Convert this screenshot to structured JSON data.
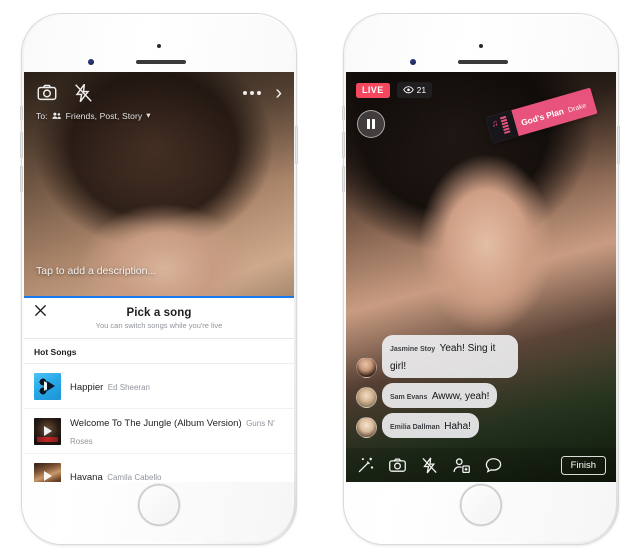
{
  "phone_left": {
    "name": "facebook-live-camera-song-picker",
    "camera_bar": {
      "flip_camera_icon": "camera-flip-icon",
      "flash_icon": "flash-off-icon",
      "more_icon": "more-options-icon",
      "next_icon": "chevron-right-icon"
    },
    "audience": {
      "prefix": "To:",
      "friends_icon": "friends-icon",
      "text": "Friends, Post, Story",
      "caret": "▾"
    },
    "description_placeholder": "Tap to add a description...",
    "sheet": {
      "close_icon": "close-icon",
      "title": "Pick a song",
      "subtitle": "You can switch songs while you're live",
      "section": "Hot Songs",
      "songs": [
        {
          "title": "Happier",
          "artist": "Ed Sheeran",
          "art": "a1"
        },
        {
          "title": "Welcome To The Jungle (Album Version)",
          "artist": "Guns N' Roses",
          "art": "a2"
        },
        {
          "title": "Havana",
          "artist": "Camila Cabello",
          "art": "a3"
        }
      ]
    }
  },
  "phone_right": {
    "name": "facebook-live-broadcast",
    "live_label": "LIVE",
    "viewer_icon": "eye-icon",
    "viewer_count": "21",
    "pause_icon": "pause-icon",
    "music_sticker": {
      "title": "God's Plan",
      "artist": "Drake",
      "note_icon": "music-note-icon"
    },
    "comments": [
      {
        "name": "Jasmine Stoy",
        "message": "Yeah! Sing it girl!"
      },
      {
        "name": "Sam Evans",
        "message": "Awww, yeah!"
      },
      {
        "name": "Emilia Dallman",
        "message": "Haha!"
      }
    ],
    "toolbar": {
      "effects_icon": "magic-wand-icon",
      "flip_camera_icon": "camera-flip-icon",
      "flash_icon": "flash-off-icon",
      "invite_icon": "add-person-icon",
      "comment_icon": "comment-bubble-icon",
      "finish_label": "Finish"
    }
  },
  "colors": {
    "live_red": "#f5485f",
    "sticker_pink": "#e8537d",
    "accent_blue": "#1778f2"
  }
}
